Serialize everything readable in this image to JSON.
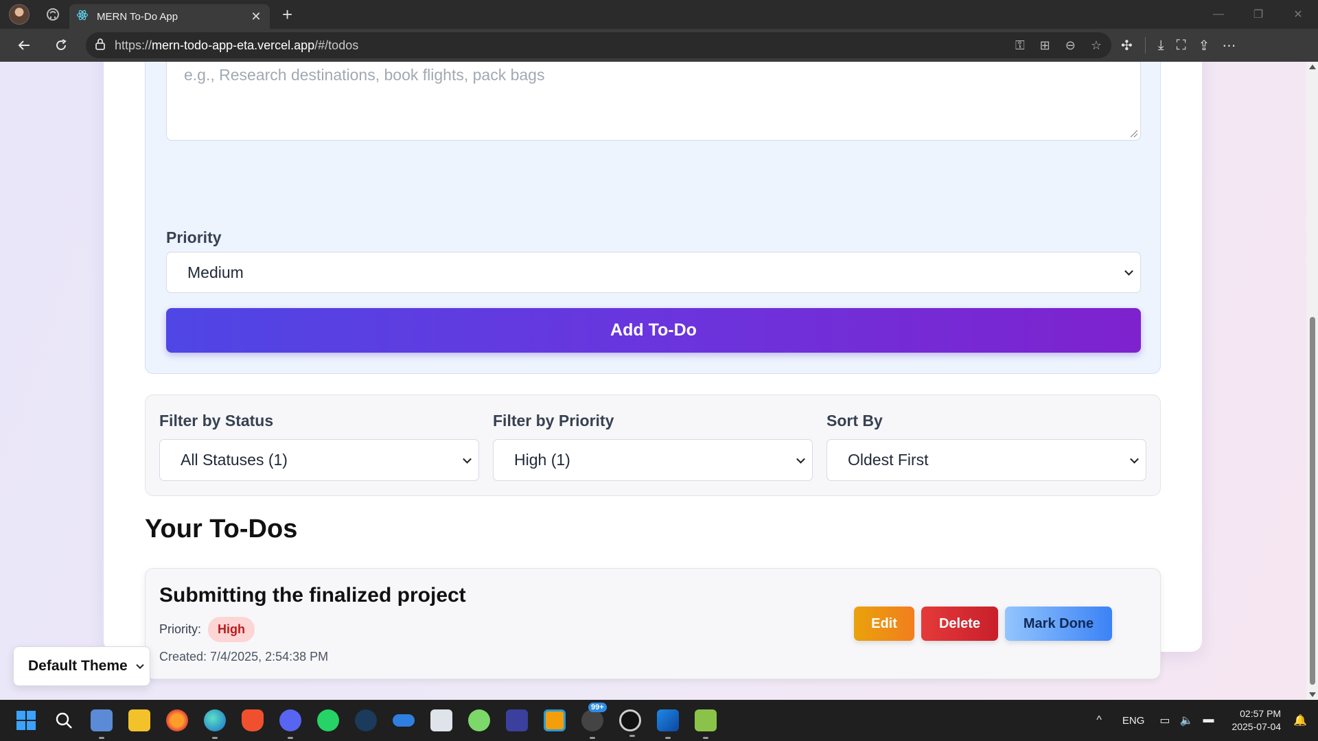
{
  "browser": {
    "tab_title": "MERN To-Do App",
    "tab_close": "✕",
    "new_tab": "+",
    "url_scheme": "https://",
    "url_host": "mern-todo-app-eta.vercel.app",
    "url_path": "/#/todos"
  },
  "form": {
    "description_placeholder": "e.g., Research destinations, book flights, pack bags",
    "priority_label": "Priority",
    "priority_value": "Medium",
    "add_button": "Add To-Do"
  },
  "filters": {
    "status_label": "Filter by Status",
    "status_value": "All Statuses (1)",
    "priority_label": "Filter by Priority",
    "priority_value": "High (1)",
    "sort_label": "Sort By",
    "sort_value": "Oldest First"
  },
  "list": {
    "heading": "Your To-Dos",
    "items": [
      {
        "title": "Submitting the finalized project",
        "priority_label": "Priority:",
        "priority": "High",
        "created": "Created: 7/4/2025, 2:54:38 PM",
        "edit": "Edit",
        "delete": "Delete",
        "mark_done": "Mark Done"
      }
    ]
  },
  "theme": {
    "value": "Default Theme"
  },
  "taskbar": {
    "language": "ENG",
    "time": "02:57 PM",
    "date": "2025-07-04",
    "notification_badge": "99+"
  },
  "colors": {
    "accent_start": "#4f46e5",
    "accent_end": "#7e22ce",
    "edit": "#f29b12",
    "delete": "#dc2626",
    "mark_done": "#60a5fa",
    "priority_high_bg": "#fdd5d5",
    "priority_high_text": "#b91c1c"
  }
}
